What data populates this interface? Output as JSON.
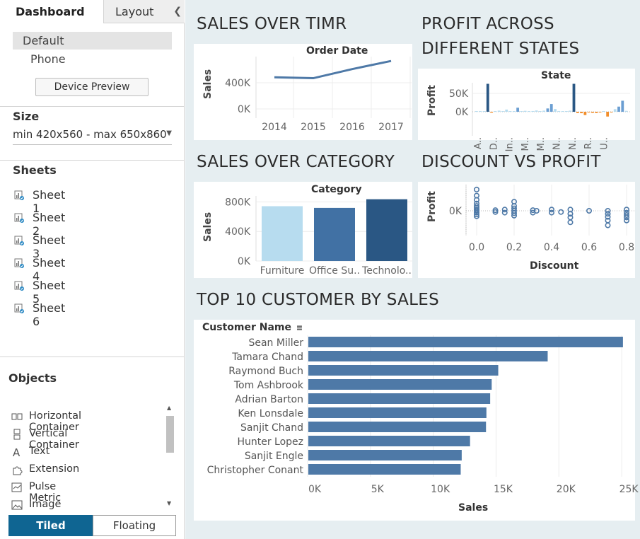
{
  "left_panel": {
    "tabs": {
      "dashboard": "Dashboard",
      "layout": "Layout"
    },
    "devices": [
      "Default",
      "Phone"
    ],
    "device_preview_button": "Device Preview",
    "size_title": "Size",
    "size_value": "min 420x560 - max 650x860",
    "sheets_title": "Sheets",
    "sheets": [
      "Sheet 1",
      "Sheet 2",
      "Sheet 3",
      "Sheet 4",
      "Sheet 5",
      "Sheet 6"
    ],
    "objects_title": "Objects",
    "objects": [
      {
        "label": "Horizontal Container",
        "icon": "horizontal-container-icon"
      },
      {
        "label": "Vertical Container",
        "icon": "vertical-container-icon"
      },
      {
        "label": "Text",
        "icon": "text-icon"
      },
      {
        "label": "Extension",
        "icon": "extension-icon"
      },
      {
        "label": "Pulse Metric",
        "icon": "pulse-metric-icon"
      },
      {
        "label": "Image",
        "icon": "image-icon"
      }
    ],
    "layout_toggle": {
      "tiled": "Tiled",
      "floating": "Floating",
      "selected": "Tiled"
    }
  },
  "dashboard": {
    "titles": {
      "sales_time": "SALES OVER TIMR",
      "profit_states_1": "PROFIT ACROSS",
      "profit_states_2": "DIFFERENT STATES",
      "sales_category": "SALES OVER CATEGORY",
      "discount_profit": "DISCOUNT VS PROFIT",
      "top_customers": "TOP 10 CUSTOMER BY SALES"
    },
    "colors": {
      "blue": "#4e79a7",
      "light_blue": "#b7dcef",
      "dark_blue": "#2a5784",
      "orange": "#f28e2b",
      "canvas": "#e6eef1"
    }
  },
  "chart_data": [
    {
      "type": "line",
      "name": "sales-over-time",
      "header": "Order Date",
      "xlabel": "",
      "ylabel": "Sales",
      "x": [
        "2014",
        "2015",
        "2016",
        "2017"
      ],
      "values": [
        484000,
        470000,
        609000,
        733000
      ],
      "ylim": [
        0,
        800000
      ],
      "yticks": [
        "0K",
        "400K"
      ]
    },
    {
      "type": "bar",
      "name": "profit-across-states",
      "header": "State",
      "ylabel": "Profit",
      "yticks": [
        "0K",
        "50K"
      ],
      "ylim": [
        -25000,
        80000
      ],
      "tick_labels": [
        "A..",
        "D..",
        "In..",
        "M..",
        "M..",
        "N..",
        "N..",
        "R..",
        "U.."
      ],
      "values": [
        1500,
        2000,
        0,
        76000,
        -2500,
        1000,
        3000,
        800,
        6000,
        1500,
        500,
        11000,
        1000,
        2500,
        500,
        2000,
        3500,
        1000,
        3000,
        9000,
        21000,
        7500,
        2000,
        1500,
        500,
        3000,
        76000,
        -3500,
        -4000,
        -9000,
        -1000,
        -3000,
        -3500,
        -1500,
        1200,
        -13000,
        -800,
        7000,
        14000,
        30000,
        2500
      ]
    },
    {
      "type": "bar",
      "name": "sales-over-category",
      "header": "Category",
      "ylabel": "Sales",
      "categories": [
        "Furniture",
        "Office Su..",
        "Technolo.."
      ],
      "tick_labels": [
        "Furniture",
        "Office Su..",
        "Technolo.."
      ],
      "values": [
        742000,
        719000,
        836000
      ],
      "colors": [
        "#b7dcef",
        "#4171a4",
        "#2a5784"
      ],
      "ylim": [
        0,
        900000
      ],
      "yticks": [
        "0K",
        "400K",
        "800K"
      ]
    },
    {
      "type": "scatter",
      "name": "discount-vs-profit",
      "xlabel": "Discount",
      "ylabel": "Profit",
      "xticks": [
        "0.0",
        "0.2",
        "0.4",
        "0.6",
        "0.8"
      ],
      "yticks": [
        "0K"
      ],
      "xlim": [
        -0.05,
        0.85
      ],
      "points": [
        [
          0,
          3500
        ],
        [
          0,
          2500
        ],
        [
          0,
          1800
        ],
        [
          0,
          1200
        ],
        [
          0,
          800
        ],
        [
          0,
          500
        ],
        [
          0,
          200
        ],
        [
          0,
          0
        ],
        [
          0,
          -300
        ],
        [
          0,
          -600
        ],
        [
          0,
          -900
        ],
        [
          0.1,
          100
        ],
        [
          0.1,
          -200
        ],
        [
          0.15,
          200
        ],
        [
          0.15,
          -300
        ],
        [
          0.2,
          1500
        ],
        [
          0.2,
          800
        ],
        [
          0.2,
          400
        ],
        [
          0.2,
          0
        ],
        [
          0.2,
          -400
        ],
        [
          0.2,
          -800
        ],
        [
          0.3,
          100
        ],
        [
          0.3,
          -300
        ],
        [
          0.32,
          0
        ],
        [
          0.4,
          200
        ],
        [
          0.4,
          -300
        ],
        [
          0.45,
          -200
        ],
        [
          0.5,
          200
        ],
        [
          0.5,
          -500
        ],
        [
          0.5,
          -1100
        ],
        [
          0.5,
          -1900
        ],
        [
          0.6,
          0
        ],
        [
          0.7,
          0
        ],
        [
          0.7,
          -500
        ],
        [
          0.7,
          -1000
        ],
        [
          0.7,
          -1600
        ],
        [
          0.7,
          -2400
        ],
        [
          0.8,
          200
        ],
        [
          0.8,
          -300
        ],
        [
          0.8,
          -700
        ],
        [
          0.8,
          -1100
        ],
        [
          0.8,
          -1600
        ]
      ]
    },
    {
      "type": "bar",
      "orientation": "horizontal",
      "name": "top-10-customers",
      "row_header": "Customer Name",
      "xlabel": "Sales",
      "categories": [
        "Sean Miller",
        "Tamara Chand",
        "Raymond Buch",
        "Tom Ashbrook",
        "Adrian Barton",
        "Ken Lonsdale",
        "Sanjit Chand",
        "Hunter Lopez",
        "Sanjit Engle",
        "Christopher Conant"
      ],
      "values": [
        25043,
        19052,
        15117,
        14596,
        14474,
        14175,
        14142,
        12873,
        12209,
        12129
      ],
      "xlim": [
        0,
        25500
      ],
      "xticks": [
        "0K",
        "5K",
        "10K",
        "15K",
        "20K",
        "25K"
      ]
    }
  ]
}
